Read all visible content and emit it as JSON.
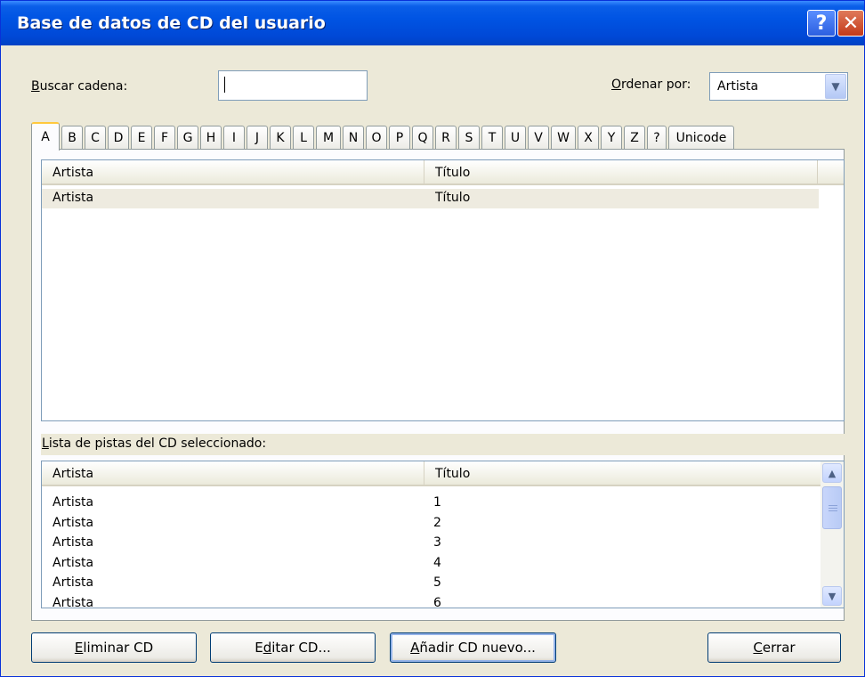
{
  "window": {
    "title": "Base de datos de CD del usuario",
    "help_glyph": "?",
    "close_glyph": "✕"
  },
  "search": {
    "label_first": "B",
    "label_rest": "uscar cadena:",
    "value": ""
  },
  "sort": {
    "label_first": "O",
    "label_rest": "rdenar por:",
    "selected": "Artista"
  },
  "tabs": [
    "A",
    "B",
    "C",
    "D",
    "E",
    "F",
    "G",
    "H",
    "I",
    "J",
    "K",
    "L",
    "M",
    "N",
    "O",
    "P",
    "Q",
    "R",
    "S",
    "T",
    "U",
    "V",
    "W",
    "X",
    "Y",
    "Z",
    "?",
    "Unicode"
  ],
  "active_tab": "A",
  "cd_list": {
    "columns": [
      "Artista",
      "Título"
    ],
    "rows": [
      {
        "artist": "Artista",
        "title": "Título"
      }
    ]
  },
  "track_list": {
    "label_first": "L",
    "label_rest": "ista de pistas del CD seleccionado:",
    "columns": [
      "Artista",
      "Título"
    ],
    "rows": [
      {
        "artist": "Artista",
        "title": "1"
      },
      {
        "artist": "Artista",
        "title": "2"
      },
      {
        "artist": "Artista",
        "title": "3"
      },
      {
        "artist": "Artista",
        "title": "4"
      },
      {
        "artist": "Artista",
        "title": "5"
      },
      {
        "artist": "Artista",
        "title": "6"
      }
    ]
  },
  "buttons": {
    "delete": {
      "first": "E",
      "rest": "liminar CD"
    },
    "edit": {
      "pre": "E",
      "u": "d",
      "rest": "itar CD..."
    },
    "add": {
      "first": "A",
      "rest": "ñadir CD nuevo..."
    },
    "close": {
      "first": "C",
      "rest": "errar"
    }
  },
  "icons": {
    "help": "help-icon",
    "close": "close-icon",
    "dropdown": "chevron-down-icon",
    "scroll_up": "chevron-up-icon",
    "scroll_down": "chevron-down-icon"
  },
  "colors": {
    "title_bar": "#0054E3",
    "dialog_bg": "#ECE9D8",
    "active_tab_accent": "#FFC83C"
  }
}
